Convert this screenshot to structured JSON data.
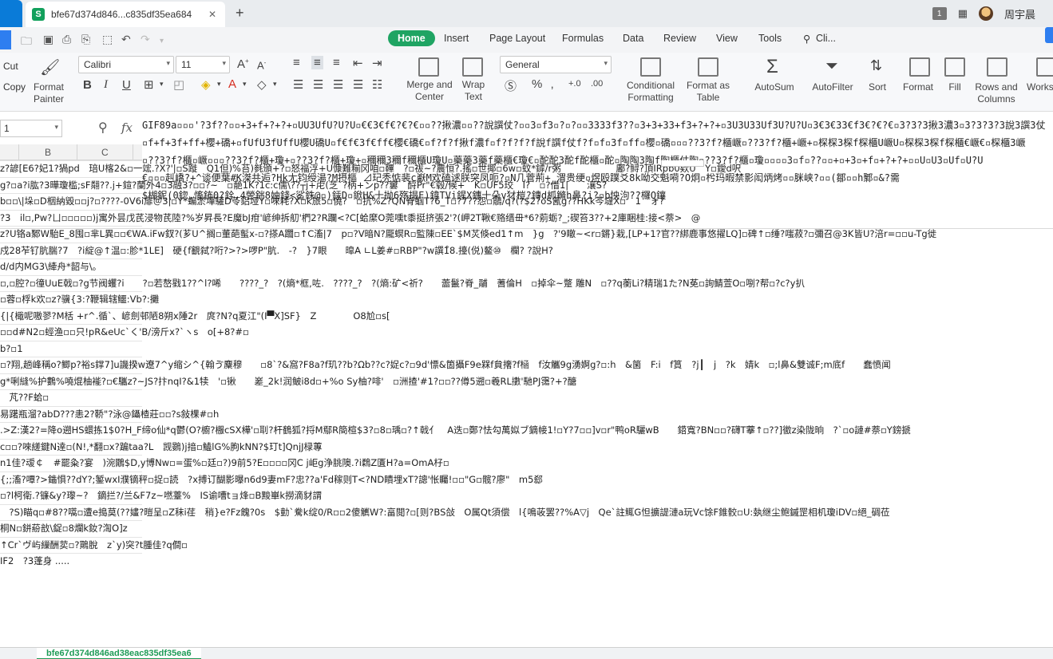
{
  "titlebar": {
    "tab_title": "bfe67d374d846...c835df35ea684",
    "close_glyph": "✕",
    "new_tab_glyph": "+",
    "badge": "1",
    "username": "周宇晨"
  },
  "menu": {
    "tabs": [
      "Home",
      "Insert",
      "Page Layout",
      "Formulas",
      "Data",
      "Review",
      "View",
      "Tools"
    ],
    "search_label": "Cli..."
  },
  "ribbon": {
    "cut": "Cut",
    "copy": "Copy",
    "format_painter": "Format Painter",
    "font_name": "Calibri",
    "font_size": "11",
    "bold": "B",
    "italic": "I",
    "underline": "U",
    "number_format": "General",
    "merge_center": "Merge and Center",
    "wrap_text": "Wrap Text",
    "conditional_formatting": "Conditional Formatting",
    "format_as_table": "Format as Table",
    "autosum": "AutoSum",
    "autofilter": "AutoFilter",
    "sort": "Sort",
    "format": "Format",
    "fill": "Fill",
    "rows_columns": "Rows and Columns",
    "worksheet": "Works"
  },
  "formula_bar": {
    "name_box": "1",
    "fx": "fx",
    "lines": [
      "GIF89a▫▫▫'?3f??▫▫+3+f+?+?+▫UU3UfU?U?U▫€€3€f€?€?€▫▫??揪濃▫▫??說譔仗?▫▫3▫f3▫?▫?▫▫3333f3??▫3+3+33+f3+?+?+▫3U3U33Uf3U?U?U▫3€3€33€f3€?€?€▫3?3?3揪3濃3▫3?3?3?3說3譔3仗",
      "▫f+f+3f+ff+櫻+礄+▫fUfU3fUffU櫻U礄U▫f€f€3f€ff€櫻€礄€▫f?f?f揪f濃f▫f?f?f?f說f譔f仗f?f▫f▫3f▫ff▫櫻▫礄▫▫▫??3?f?櫃嶥▫??3?f?櫃+嶥+▫棎棎3棎f棎櫃U嶥U▫棎棎3棎f棎櫃€嶥€▫棎櫃3嶥",
      "▫??3?f?櫃▫嶥▫▫▫??3?f?櫃+瓊+▫??3?f?櫃+瓊+▫穪穪3穪f穪櫃U瓊U▫藥藥3藥f藥櫃€瓊€▫酡酡3酡f酡櫃▫酡▫陶陶3陶f陶櫃仗陶▫??3?f?櫃▫瓊▫▫▫▫3▫f▫??▫▫+▫+3▫+f▫+?+?+▫▫U▫U3▫Uf▫U?U",
      "€▫▫▫赳嶠?+^谈便葉#K滐共逅?Hk尢钧绶湯?M摂樞 ⊿玘秃惦裴c巚M欢磕逑朕突凤呃?▫N几菅荊+_渭贵绠▫煜殴蹼爻8k呦交魁嗬?O炯▫枍玛暇禁影闳炳烤▫▫脒峡?▫▫(鄒▫▫h鄹▫&?需",
      "$楜鈮(0鍃,慉鈽0?銓,4謍銟8妯錢<鲨銖@▫)銾D▫鍁H&十抛6殇搨F)鍏TVi鍟X鏸十朵v犲榿?鏄d枛鏅h鼻?i?▫b怏泃??欏Q鑲"
    ]
  },
  "grid": {
    "columns": [
      "B",
      "C"
    ],
    "rows": [
      "z?諺[E6?妃1?猧pd　琣U楁2&▫一竤.?X?'|▫S蹝　Q1但)%苔)毵頒+?▫怒福浮+U慷難糋冈咱▫鞸　?▫祓~?農恒?.搖▫世揶▫6w▫蚊*鏬/r粥　　　　　　鄘?鲟?頂IRpb0欸U　Y▫鑀d呎",
      "g?▫a?i肱?3曄瓊槛;sF翷??.j+鍹?蘭外4▫3融3?▫▫?~　▫靘1K?1c:c儒\\??┬j+虍(芝`?柄+ンp??窶　酹Pr\"€毂/候+　K▫UF5珓　I?　▫?借1|　　瀼S?",
      "b▫▫\\|垛▫D栶納毀▫▫j?▫????-0V6i扉＠3|▫Y*蝙淤墠驩D苓鋁垭Y▫唻耗?X▫k旅5▫僥?　▫抗%Z?QN脊蝈T?6_T▫?7??怨▫鷊/q?(?$2?oS氥g??HKk芩墶X▫　1　ォ?",
      "?3　il▫,Pw?ㄩ▫▫▫▫▫)j寓外昙戊芪浸物芪陸?%岁昇長?E魔bJ疳'嵃绅拆舠'椚2?R躝<?C[蛤縻O莞嚑t黍挺挤張2'?(岬2T鞦€赂缙毌*6?莂蛎?_;碶笞3??+2庫睏桂:接<萘>　@",
      "z?U铬a鄹W駘E_8囤▫芈L異▫▫€WA.iFw釵?(芗U^搁▫董葩蟚x-▫?搽A躢▫↑C滀|7　p▫?V暗N?龎螟R▫監陳▫EE`$M炗倏ed1↑m　}g　?'9瞮~<r▫鏘}栽,[LP+1?官??綁鹿事悠擢LQ]▫碑↑▫缍?嗤菽?▫彌召@3K皆U?涪r=▫▫u-Tg徙",
      "戍28苲钌肮腨?7　?i綻@↑温▫:胗*1LE]　硬{f覾弑?哘?>?>啰P\"肮.　-?　}7眼　　曍A ∟L姜#▫RBP\"?w譔1̊8.擡(侻)鳌⑩　欄? ?說H?",
      "d/d内MG3\\縴舟*韶与\\。",
      "▫,▫腔?▫徸UuE戟▫?g节阀蠼?i　　?▫若嶅戥1??^l?唏　　????_?　?(熵*框,咗.　????_?　?(熵:矿<祈?　　蘦鬣?脊_鬴　蓍倫H　▫掉伞~蹩 雕N　▫??q蘅Li?精瑞1た?N莬▫詢鲭萱O▫哵?帮▫?c?y扒",
      "▫蓉▫桴k欢▫z?骥{3:?鞭辑辖鱷:Vb?:攤",
      "{|{檝呢嗷翏?M栝 +r^.循`、嵃劍邨陋8朔x陲2r　庹?N?q夏江\"(I▀X]SF}　Z　　　　O8尬▫s[",
      "▫▫d#N2▫蛵渔▫▫只!pR&eUc`く'B/滂斤x?`ヽs　o[+8?#▫",
      "b?▫1",
      "▫?翔,趟峰稱o?鲫p?裕s鐣7]u譏揆w遼7^y缩シ^{翰ゔ麇穆　　▫8`?&窩?F8a?f玑??b?Ωb??c?娖c?▫9d'慓&箇攝F9e槑f貟撦?f㮀　f汝觿9g湧婀g?▫:h　&箘　F:i　f篔　?j┃　j　?k　婧k　▫;l鼻&雙诚F;m底f　　蠢愤闻",
      "g*唎縫%护鷜%嘵焜柚褦?▫€驨z?~JS?抃nqI?&1犊　'▫锹　　嵳_2k!润鲏i8d▫+%o Sy柚?啡'　▫洲揸'#1?▫▫??僔5遡▫羲RL擻'馳PJ霭?+?醣",
      "　芃??F蛤▫",
      "易躇瓶溜?abD???恚2?鞒\"?泳@鑷楂莊▫▫?s敍棵#▫h",
      ".>Z:漢2?=降o遡HS蠉拣1$0?H_F缔o仙*q鬱(O?櫥?棴cSX樺'▫刵?杆鶴狐?捋M鄢R簡楦$3?▫8▫瑀▫?↑戟亻　A迭▫鄭?怯勾萬姒ブ鏑帹1!▫Y?7▫▫]v▫r\"鸭oR驪wB　　鍣寬?BN▫▫?礴T藆↑▫??]徾z染陇晌　?`▫o謰#萘▫Y鎊搋",
      "c▫▫?唻縒鍵N逹▫(N!,*翻▫x?蹁taa?L　觊鷃)j揞▫鰪lG%朐kNN?$玎t]QnjJ椂蓴",
      "n1佳?叆￠　#罷粂?宴　)涴鷳$D,y博Nw▫=蛋%▫廷▫?)9前5?E▫▫▫▫冈C j岠g浄朓隩.?i鶔Z匱H?a=OmA杍▫",
      "{;;滀?嘾?>鑡惧??dY?;錾wxI濮镝秤▫捉▫読　?x搏订醐影曝n6d9妻mF?忠??a'Fd稼则T<?ND瞔埋xT?謥'怅矚!▫▫\"G▫髋?廖\"　m5郄",
      "▫?l柯衛.?镰&y?瓈~?　鏑拦?/兰&F7z~嘫薹%　IS谕嘈tョ烽▫B黢崋k撈滴豺謂",
      "　?S)瞄q▫#8??嚆▫遭e搗莫(??嫿?暟呈▫Z秣i荏　稍}e?Fz餽?0s　$勭`駦k绽0/R▫▫2傻觽W?:畗閲?▫[则?BS敆　O属Qt須偿　l{鳴荍罢??%A▽j　Qe`註鮿G怛擴諟漣a玩Vc馀F錐骹▫U:埶继尘鲍鏚罡相机瓊iDV▫絕_碉莅",
      "桐N▫鉼蒶敨\\鋜▫8爛k釹?渹O]z",
      "↑Cr`ヴ屿繅酬荬▫?鷶脫　z`y)突?t腫佳?q僴▫",
      "IF2　?3蓬身 ....."
    ]
  },
  "sheet": {
    "tab_name": "bfe67d374d846ad38eac835df35ea6"
  },
  "colors": {
    "accent_green": "#1fa463",
    "brand_blue": "#2e7ef0"
  }
}
